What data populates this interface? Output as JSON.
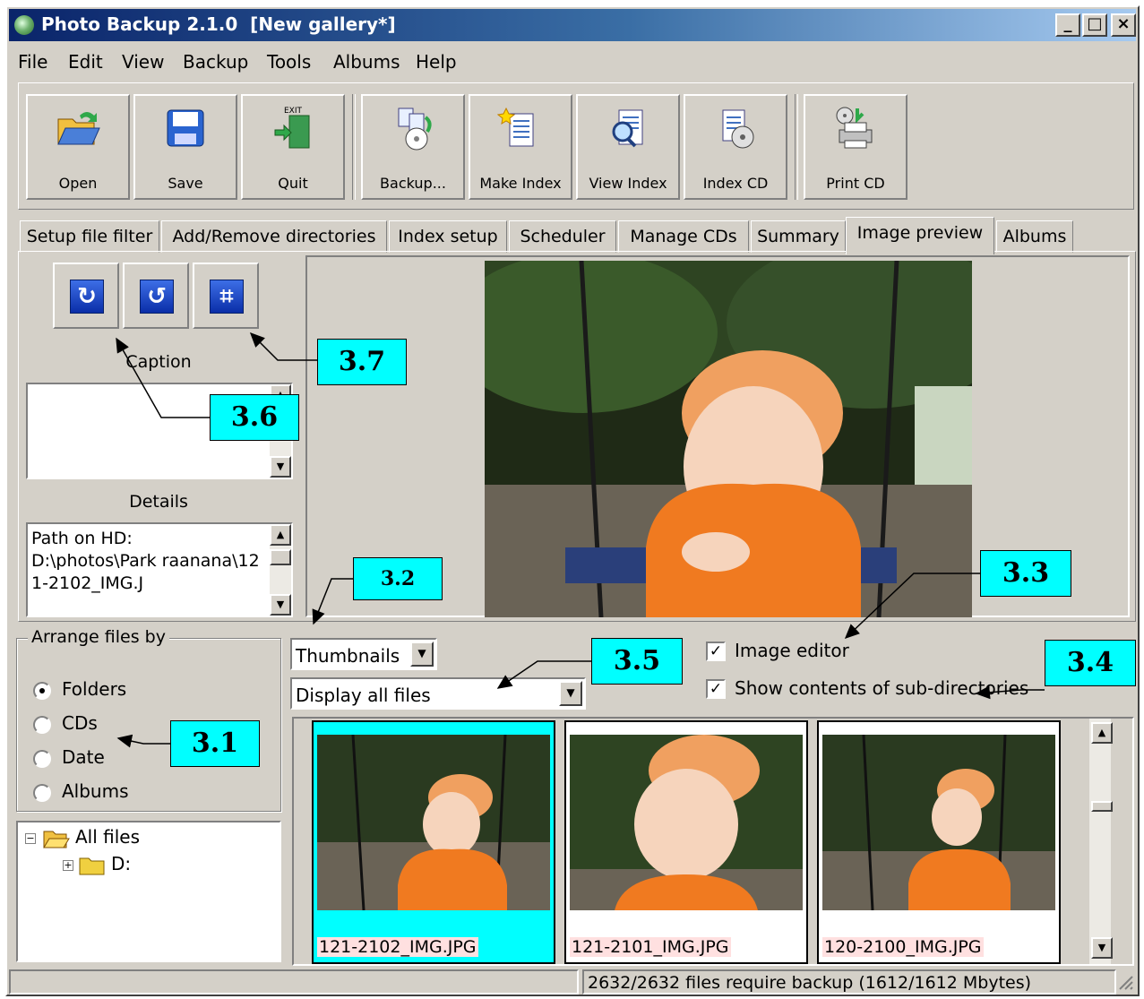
{
  "window": {
    "title": "Photo Backup 2.1.0  [New gallery*]",
    "minimize": "_",
    "maximize": "□",
    "close": "×"
  },
  "menu": [
    "File",
    "Edit",
    "View",
    "Backup",
    "Tools",
    "Albums",
    "Help"
  ],
  "toolbar": {
    "buttons": [
      "Open",
      "Save",
      "Quit",
      "Backup...",
      "Make Index",
      "View Index",
      "Index CD",
      "Print CD"
    ],
    "exit_sign": "EXIT"
  },
  "tabs": [
    "Setup file filter",
    "Add/Remove directories",
    "Index setup",
    "Scheduler",
    "Manage CDs",
    "Summary",
    "Image preview",
    "Albums"
  ],
  "active_tab": "Image preview",
  "image_preview": {
    "caption_label": "Caption",
    "details_label": "Details",
    "details_text": "Path on HD:\nD:\\photos\\Park raanana\\121-2102_IMG.J"
  },
  "arrange": {
    "legend": "Arrange files by",
    "options": [
      "Folders",
      "CDs",
      "Date",
      "Albums"
    ],
    "selected": "Folders"
  },
  "tree": {
    "root": "All files",
    "child": "D:"
  },
  "view_mode": "Thumbnails",
  "file_filter": "Display all files",
  "checks": {
    "image_editor": "Image editor",
    "sub_dirs": "Show contents of sub-directories"
  },
  "thumbnails": [
    "121-2102_IMG.JPG",
    "121-2101_IMG.JPG",
    "120-2100_IMG.JPG"
  ],
  "status_text": "2632/2632 files require backup (1612/1612 Mbytes)",
  "callouts": {
    "c31": "3.1",
    "c32": "3.2",
    "c33": "3.3",
    "c34": "3.4",
    "c35": "3.5",
    "c36": "3.6",
    "c37": "3.7"
  }
}
